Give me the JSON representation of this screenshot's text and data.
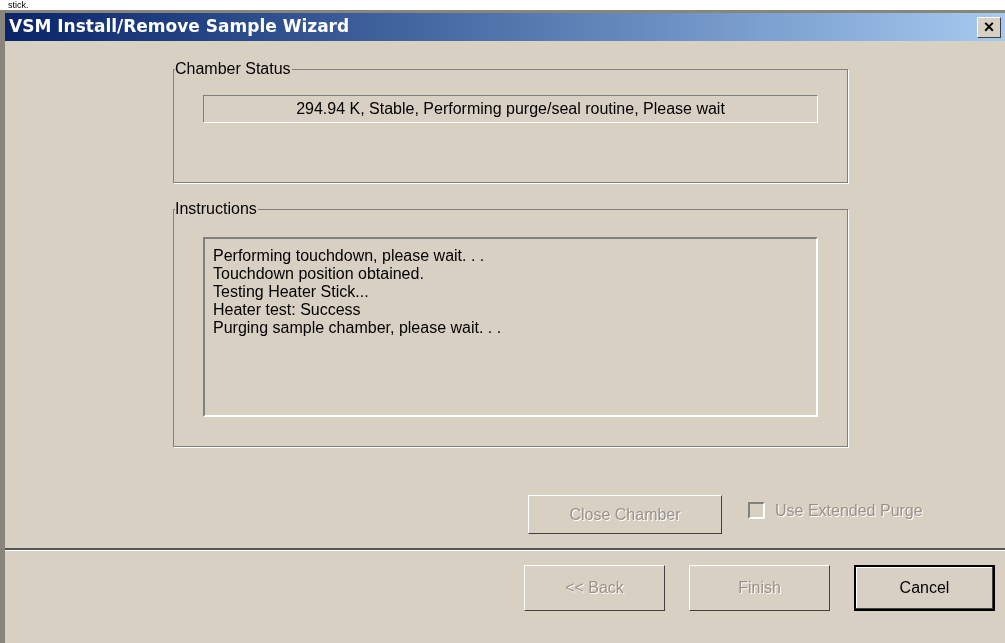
{
  "page_text": "stick.",
  "window": {
    "title": "VSM Install/Remove Sample Wizard",
    "close": "×"
  },
  "chamber_status": {
    "label": "Chamber Status",
    "value": "294.94 K, Stable, Performing purge/seal routine, Please wait"
  },
  "instructions": {
    "label": "Instructions",
    "lines": [
      "Performing touchdown, please wait. . .",
      "Touchdown position obtained.",
      "Testing Heater Stick...",
      "Heater test: Success",
      "Purging sample chamber, please wait. . ."
    ]
  },
  "close_chamber": {
    "label": "Close Chamber",
    "disabled": true
  },
  "extended_purge": {
    "label": "Use Extended Purge",
    "checked": false,
    "disabled": true
  },
  "buttons": [
    {
      "label": "<< Back",
      "disabled": true,
      "default": false
    },
    {
      "label": "Finish",
      "disabled": true,
      "default": false
    },
    {
      "label": "Cancel",
      "disabled": false,
      "default": true
    }
  ]
}
